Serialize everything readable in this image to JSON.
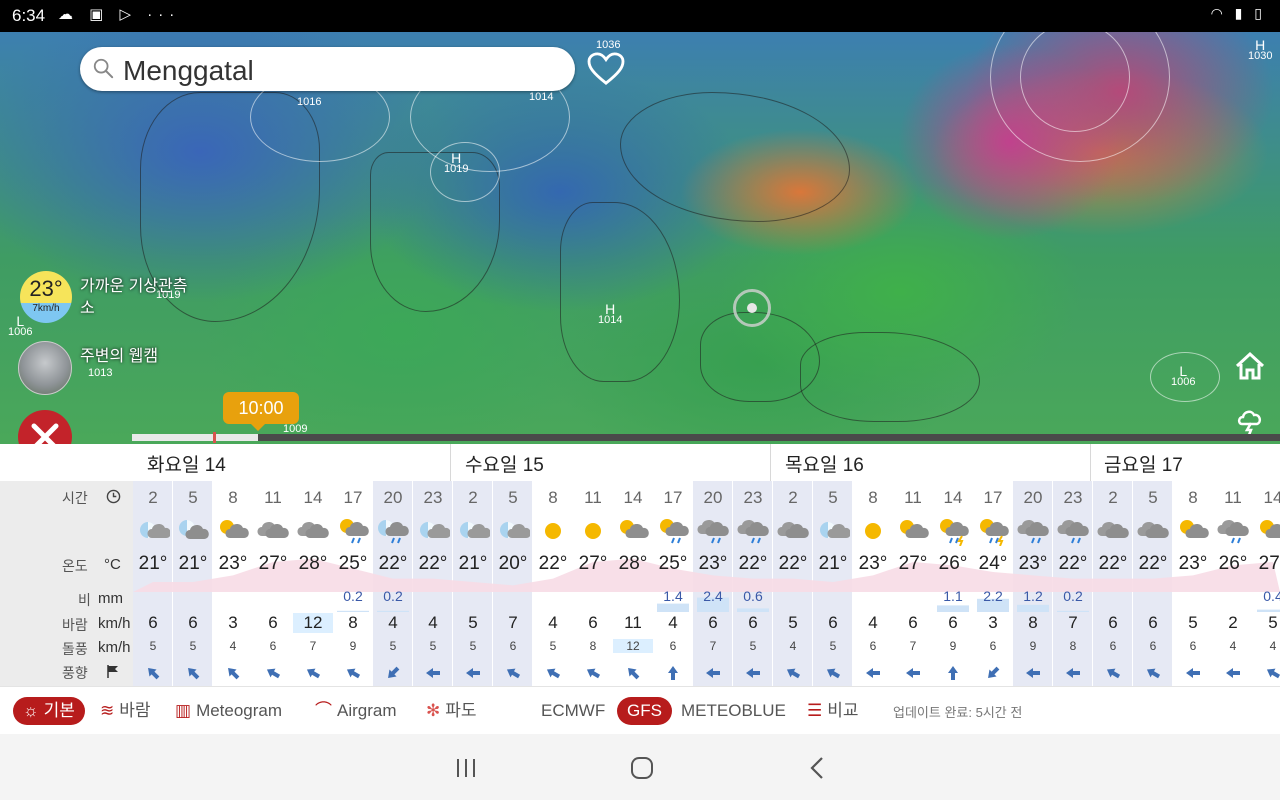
{
  "status_bar": {
    "time": "6:34",
    "icons": [
      "cloud-icon",
      "image-icon",
      "play-store-icon",
      "more-icon"
    ],
    "more": "···"
  },
  "map": {
    "search": {
      "value": "Menggatal"
    },
    "pressure_labels": [
      {
        "letter": "",
        "value": "1036"
      },
      {
        "letter": "",
        "value": "1016"
      },
      {
        "letter": "",
        "value": "1014"
      },
      {
        "letter": "H",
        "value": "1019"
      },
      {
        "letter": "H",
        "value": "1030"
      },
      {
        "letter": "H",
        "value": "1014"
      },
      {
        "letter": "L",
        "value": "1006"
      },
      {
        "letter": "L",
        "value": "1006"
      },
      {
        "letter": "",
        "value": "1013"
      },
      {
        "letter": "",
        "value": "1019"
      },
      {
        "letter": "",
        "value": "1009"
      }
    ],
    "weather_badge": {
      "temp": "23°",
      "wind": "7km/h"
    },
    "nearby_station_label": "가까운 기상관측소",
    "webcam_label": "주변의 웹캠",
    "time_bubble": "10:00",
    "timeline_progress_fraction": 0.11
  },
  "forecast": {
    "row_labels": {
      "time": "시간",
      "temp": "온도",
      "temp_unit": "°C",
      "rain": "비",
      "rain_unit": "mm",
      "wind": "바람",
      "wind_unit": "km/h",
      "gust": "돌풍",
      "gust_unit": "km/h",
      "dir": "풍향"
    },
    "days": [
      {
        "label": "화요일 14"
      },
      {
        "label": "수요일 15"
      },
      {
        "label": "목요일 16"
      },
      {
        "label": "금요일 17"
      }
    ],
    "hours": [
      "2",
      "5",
      "8",
      "11",
      "14",
      "17",
      "20",
      "23",
      "2",
      "5",
      "8",
      "11",
      "14",
      "17",
      "20",
      "23",
      "2",
      "5",
      "8",
      "11",
      "14",
      "17",
      "20",
      "23",
      "2",
      "5",
      "8",
      "11",
      "14"
    ],
    "icons": [
      "partly-night",
      "cloudy-night",
      "partly-sun",
      "cloudy",
      "cloudy",
      "sun-rain",
      "rain-night",
      "partly-night",
      "partly-night",
      "partly-night",
      "sun",
      "sun",
      "partly-sun",
      "sun-rain",
      "rain",
      "rain",
      "cloudy",
      "partly-night",
      "sun",
      "partly-sun",
      "sun-storm",
      "sun-storm",
      "rain",
      "rain",
      "cloudy",
      "cloudy",
      "partly-sun",
      "cloudy-rain",
      "partly-sun"
    ],
    "temps": [
      "21°",
      "21°",
      "23°",
      "27°",
      "28°",
      "25°",
      "22°",
      "22°",
      "21°",
      "20°",
      "22°",
      "27°",
      "28°",
      "25°",
      "23°",
      "22°",
      "22°",
      "21°",
      "23°",
      "27°",
      "26°",
      "24°",
      "23°",
      "22°",
      "22°",
      "22°",
      "23°",
      "26°",
      "27°"
    ],
    "rain": [
      "",
      "",
      "",
      "",
      "",
      "0.2",
      "0.2",
      "",
      "",
      "",
      "",
      "",
      "",
      "1.4",
      "2.4",
      "0.6",
      "",
      "",
      "",
      "",
      "1.1",
      "2.2",
      "1.2",
      "0.2",
      "",
      "",
      "",
      "",
      "0.4"
    ],
    "wind": [
      "6",
      "6",
      "3",
      "6",
      "12",
      "8",
      "4",
      "4",
      "5",
      "7",
      "4",
      "6",
      "11",
      "4",
      "6",
      "6",
      "5",
      "6",
      "4",
      "6",
      "6",
      "3",
      "8",
      "7",
      "6",
      "6",
      "5",
      "2",
      "5"
    ],
    "gust": [
      "5",
      "5",
      "4",
      "6",
      "7",
      "9",
      "5",
      "5",
      "5",
      "6",
      "5",
      "8",
      "12",
      "6",
      "7",
      "5",
      "4",
      "5",
      "6",
      "7",
      "9",
      "6",
      "9",
      "8",
      "6",
      "6",
      "6",
      "4",
      "4"
    ],
    "wind_dir_deg": [
      315,
      315,
      315,
      300,
      300,
      300,
      225,
      270,
      270,
      300,
      300,
      300,
      315,
      0,
      270,
      270,
      300,
      300,
      270,
      270,
      0,
      225,
      270,
      270,
      300,
      300,
      270,
      270,
      300
    ],
    "highlight_wind_index": 4,
    "highlight_gust_index": 12
  },
  "tabs": [
    {
      "label": "기본",
      "icon": "sun-cloud-icon",
      "active": true
    },
    {
      "label": "바람",
      "icon": "wind-icon",
      "active": false
    },
    {
      "label": "Meteogram",
      "icon": "bar-chart-icon",
      "active": false
    },
    {
      "label": "Airgram",
      "icon": "paraglider-icon",
      "active": false
    },
    {
      "label": "파도",
      "icon": "surfer-icon",
      "active": false
    }
  ],
  "models": [
    {
      "label": "ECMWF",
      "active": false
    },
    {
      "label": "GFS",
      "active": true
    },
    {
      "label": "METEOBLUE",
      "active": false
    }
  ],
  "compare": {
    "label": "비교",
    "icon": "compare-flag-icon"
  },
  "update_text": "업데이트 완료: 5시간 전",
  "colors": {
    "accent": "#b71c1c",
    "time_bubble": "#e8a10d",
    "night_column": "#e6e9f4"
  }
}
